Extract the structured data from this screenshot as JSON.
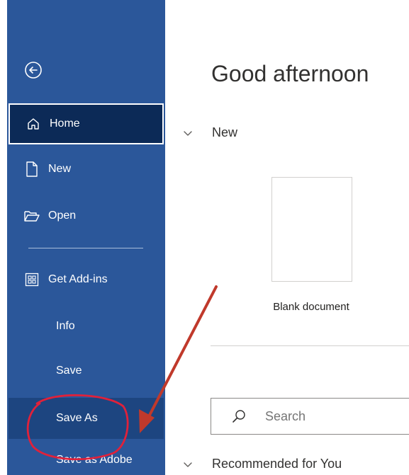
{
  "sidebar": {
    "back_icon": "circle-arrow-left-icon",
    "items": [
      {
        "label": "Home",
        "icon": "home-icon"
      },
      {
        "label": "New",
        "icon": "new-document-icon"
      },
      {
        "label": "Open",
        "icon": "folder-open-icon"
      },
      {
        "label": "Get Add-ins",
        "icon": "add-ins-grid-icon"
      },
      {
        "label": "Info"
      },
      {
        "label": "Save"
      },
      {
        "label": "Save As"
      },
      {
        "label": "Save as Adobe"
      }
    ],
    "selected": "Home",
    "colors": {
      "background": "#2b579a",
      "selected": "#0c2a57"
    }
  },
  "main": {
    "greeting": "Good afternoon",
    "new_section": {
      "heading": "New",
      "templates": [
        {
          "label": "Blank document"
        }
      ]
    },
    "search": {
      "placeholder": "Search"
    },
    "recommended_heading": "Recommended for You"
  },
  "annotation": {
    "shapes": [
      "red-arrow",
      "red-circle"
    ],
    "color": "#c0392b",
    "target": "Save As"
  }
}
